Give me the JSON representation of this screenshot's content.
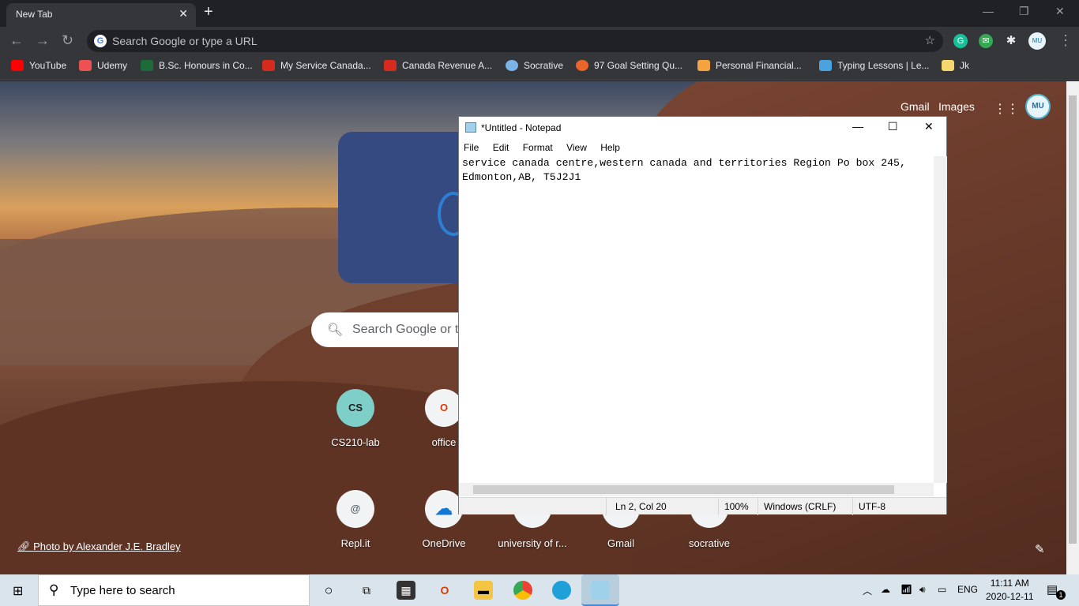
{
  "browser": {
    "tab_title": "New Tab",
    "close_glyph": "✕",
    "new_tab_glyph": "+",
    "omnibox_placeholder": "Search Google or type a URL",
    "extensions": [
      "G",
      "✉",
      "✱",
      "avatar"
    ],
    "bookmarks": [
      {
        "label": "YouTube",
        "icon": "youtube-icon",
        "color": "#ff0000"
      },
      {
        "label": "Udemy",
        "icon": "udemy-icon",
        "color": "#ec5252"
      },
      {
        "label": "B.Sc. Honours in Co...",
        "icon": "university-icon",
        "color": "#1e6b3a"
      },
      {
        "label": "My Service Canada...",
        "icon": "maple-leaf-icon",
        "color": "#d52b1e"
      },
      {
        "label": "Canada Revenue A...",
        "icon": "maple-leaf-icon",
        "color": "#d52b1e"
      },
      {
        "label": "Socrative",
        "icon": "socrative-icon",
        "color": "#7ab4e8"
      },
      {
        "label": "97 Goal Setting Qu...",
        "icon": "goal-icon",
        "color": "#e9652a"
      },
      {
        "label": "Personal Financial...",
        "icon": "finance-icon",
        "color": "#f4a340"
      },
      {
        "label": "Typing Lessons | Le...",
        "icon": "typing-icon",
        "color": "#4aa3df"
      },
      {
        "label": "Jk",
        "icon": "folder-icon",
        "color": "#f5d76e"
      }
    ]
  },
  "newtab": {
    "gmail": "Gmail",
    "images": "Images",
    "avatar_text": "MU",
    "search_placeholder": "Search Google or t",
    "shortcuts": [
      {
        "label": "CS210-lab",
        "icon_text": "CS"
      },
      {
        "label": "office",
        "icon_text": "O"
      },
      {
        "label": "Repl.it",
        "icon_text": "@"
      },
      {
        "label": "OneDrive",
        "icon_text": "☁"
      },
      {
        "label": "university of r...",
        "icon_text": "R"
      },
      {
        "label": "Gmail",
        "icon_text": "M"
      },
      {
        "label": "socrative",
        "icon_text": "S"
      }
    ],
    "photo_credit": "Photo by Alexander J.E. Bradley"
  },
  "notepad": {
    "title": "*Untitled - Notepad",
    "menu": [
      "File",
      "Edit",
      "Format",
      "View",
      "Help"
    ],
    "text": "service canada centre,western canada and territories Region Po box 245,\nEdmonton,AB, T5J2J1",
    "status": {
      "position": "Ln 2, Col 20",
      "zoom": "100%",
      "line_endings": "Windows (CRLF)",
      "encoding": "UTF-8"
    }
  },
  "taskbar": {
    "search_placeholder": "Type here to search",
    "language": "ENG",
    "time": "11:11 AM",
    "date": "2020-12-11",
    "notification_count": "1"
  },
  "colors": {
    "chrome_dark": "#202124",
    "chrome_toolbar": "#35363a",
    "taskbar": "#d9e4ec"
  }
}
